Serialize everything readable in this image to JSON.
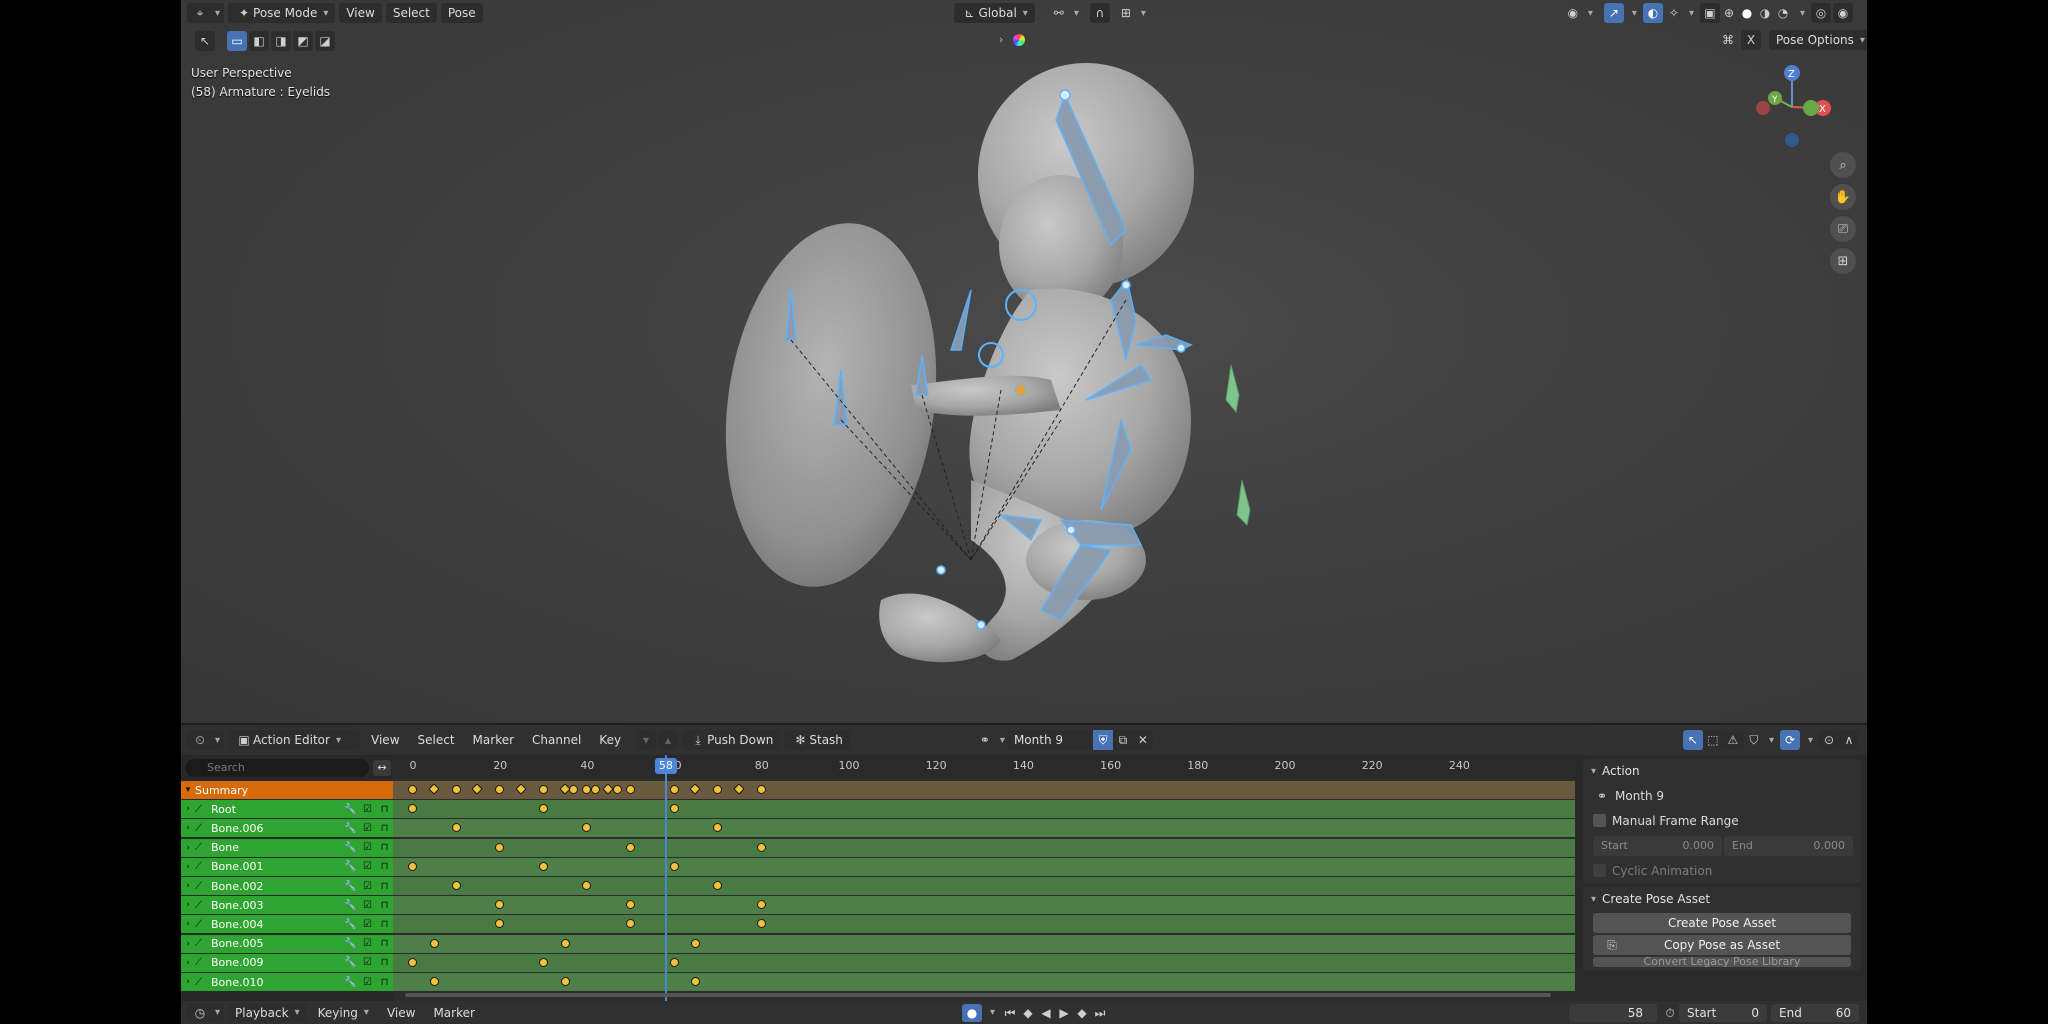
{
  "viewport": {
    "mode": "Pose Mode",
    "menus": [
      "View",
      "Select",
      "Pose"
    ],
    "orientation": "Global",
    "pose_options": "Pose Options",
    "x_label": "X",
    "info_line1": "User Perspective",
    "info_line2": "(58) Armature : Eyelids",
    "gizmo": {
      "z": "Z",
      "y": "Y",
      "x": "X"
    }
  },
  "action_editor": {
    "editor_type": "Action Editor",
    "menus": [
      "View",
      "Select",
      "Marker",
      "Channel",
      "Key"
    ],
    "push_down": "Push Down",
    "stash": "Stash",
    "action_name": "Month 9",
    "search_placeholder": "Search",
    "ruler_ticks": [
      "0",
      "20",
      "40",
      "60",
      "80",
      "100",
      "120",
      "140",
      "160",
      "180",
      "200",
      "220",
      "240"
    ],
    "current_frame": "58",
    "channels": [
      {
        "name": "Summary",
        "summary": true
      },
      {
        "name": "Root"
      },
      {
        "name": "Bone.006"
      },
      {
        "name": "Bone"
      },
      {
        "name": "Bone.001"
      },
      {
        "name": "Bone.002"
      },
      {
        "name": "Bone.003"
      },
      {
        "name": "Bone.004"
      },
      {
        "name": "Bone.005"
      },
      {
        "name": "Bone.009"
      },
      {
        "name": "Bone.010"
      }
    ],
    "keyframes": [
      [
        0,
        5,
        10,
        15,
        20,
        25,
        30,
        35,
        37,
        40,
        42,
        45,
        47,
        50,
        60,
        65,
        70,
        75,
        80
      ],
      [
        0,
        30,
        60
      ],
      [
        10,
        40,
        70
      ],
      [
        20,
        50,
        80
      ],
      [
        0,
        30,
        60
      ],
      [
        10,
        40,
        70
      ],
      [
        20,
        50,
        80
      ],
      [
        20,
        50,
        80
      ],
      [
        5,
        35,
        65
      ],
      [
        0,
        30,
        60
      ],
      [
        5,
        35,
        65
      ]
    ]
  },
  "sidebar": {
    "action_header": "Action",
    "action_name": "Month 9",
    "manual_frame_range": "Manual Frame Range",
    "start_label": "Start",
    "start_value": "0.000",
    "end_label": "End",
    "end_value": "0.000",
    "cyclic": "Cyclic Animation",
    "create_pose_header": "Create Pose Asset",
    "create_pose_btn": "Create Pose Asset",
    "copy_pose_btn": "Copy Pose as Asset",
    "legacy_btn": "Convert Legacy Pose Library"
  },
  "timeline_footer": {
    "playback": "Playback",
    "keying": "Keying",
    "view": "View",
    "marker": "Marker",
    "current_frame": "58",
    "start_label": "Start",
    "start_value": "0",
    "end_label": "End",
    "end_value": "60"
  }
}
